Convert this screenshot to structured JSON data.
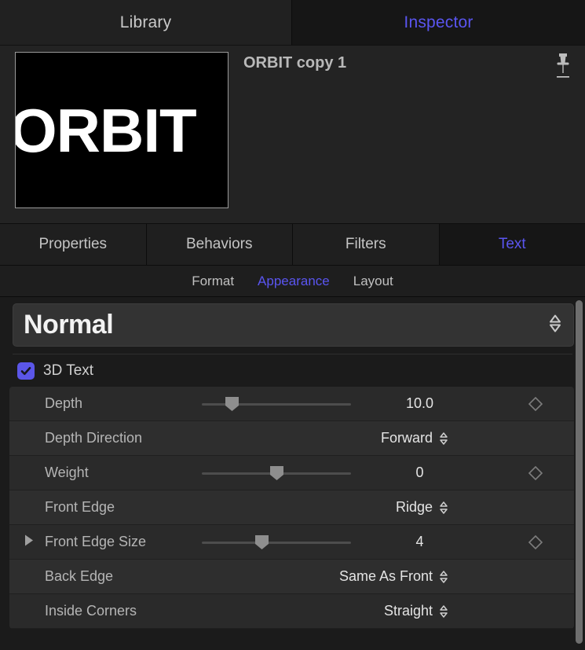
{
  "top_tabs": [
    {
      "label": "Library",
      "active": false
    },
    {
      "label": "Inspector",
      "active": true
    }
  ],
  "header": {
    "object_title": "ORBIT copy 1",
    "thumbnail_text": "ORBIT",
    "pin_icon": "pin-icon"
  },
  "main_tabs": [
    {
      "label": "Properties",
      "active": false
    },
    {
      "label": "Behaviors",
      "active": false
    },
    {
      "label": "Filters",
      "active": false
    },
    {
      "label": "Text",
      "active": true
    }
  ],
  "sub_tabs": [
    {
      "label": "Format",
      "active": false
    },
    {
      "label": "Appearance",
      "active": true
    },
    {
      "label": "Layout",
      "active": false
    }
  ],
  "style_select": {
    "value": "Normal",
    "stepper_icon": "stepper-updown-icon"
  },
  "three_d_text": {
    "label": "3D Text",
    "checked": true
  },
  "parameters": [
    {
      "name": "Depth",
      "type": "slider",
      "value": "10.0",
      "slider_percent": 20,
      "keyframe": true,
      "disclosure": false
    },
    {
      "name": "Depth Direction",
      "type": "popup",
      "value": "Forward",
      "keyframe": false,
      "disclosure": false
    },
    {
      "name": "Weight",
      "type": "slider",
      "value": "0",
      "slider_percent": 50,
      "keyframe": true,
      "disclosure": false
    },
    {
      "name": "Front Edge",
      "type": "popup",
      "value": "Ridge",
      "keyframe": false,
      "disclosure": false
    },
    {
      "name": "Front Edge Size",
      "type": "slider",
      "value": "4",
      "slider_percent": 40,
      "keyframe": true,
      "disclosure": true
    },
    {
      "name": "Back Edge",
      "type": "popup",
      "value": "Same As Front",
      "keyframe": false,
      "disclosure": false
    },
    {
      "name": "Inside Corners",
      "type": "popup",
      "value": "Straight",
      "keyframe": false,
      "disclosure": false
    }
  ],
  "colors": {
    "accent": "#5a55f0",
    "checkbox": "#5b56e8",
    "row": "#2a2a2a",
    "row_alt": "#2e2e2e",
    "text": "#b5b5b5",
    "value_text": "#e4e4e4"
  }
}
